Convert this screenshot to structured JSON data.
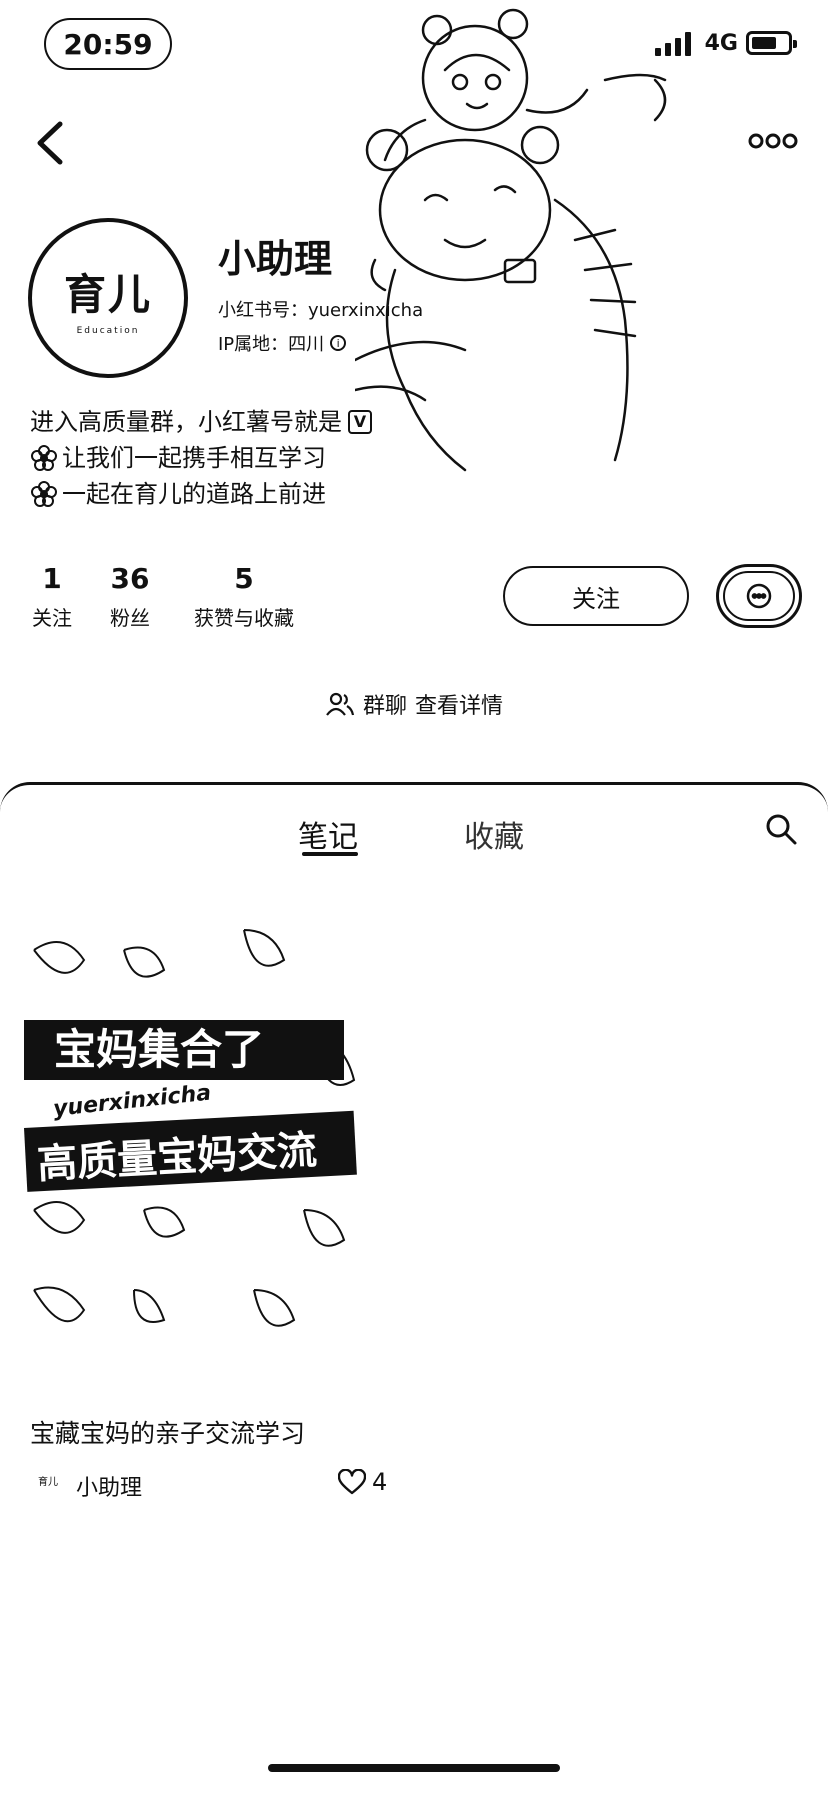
{
  "status_bar": {
    "time": "20:59",
    "network": "4G",
    "battery_level": 0.7
  },
  "profile": {
    "avatar": {
      "main_text": "育儿",
      "sub_text": "Education"
    },
    "nickname": "小助理",
    "redbook_id": "小红书号：yuerxinxicha",
    "ip_location": "IP属地：四川",
    "bio": [
      "进入高质量群，小红薯号就是",
      "让我们一起携手相互学习",
      "一起在育儿的道路上前进"
    ],
    "bio_badge": "V"
  },
  "stats": [
    {
      "value": "1",
      "label": "关注"
    },
    {
      "value": "36",
      "label": "粉丝"
    },
    {
      "value": "5",
      "label": "获赞与收藏"
    }
  ],
  "actions": {
    "follow_label": "关注"
  },
  "group": {
    "label": "群聊",
    "link": "查看详情"
  },
  "tabs": [
    {
      "label": "笔记",
      "active": true
    },
    {
      "label": "收藏",
      "active": false
    }
  ],
  "notes": [
    {
      "image_texts": [
        "宝妈集合了",
        "yuerxinxicha",
        "高质量宝妈交流"
      ],
      "title": "宝藏宝妈的亲子交流学习",
      "author": "小助理",
      "author_logo": "育儿",
      "likes": "4"
    }
  ]
}
